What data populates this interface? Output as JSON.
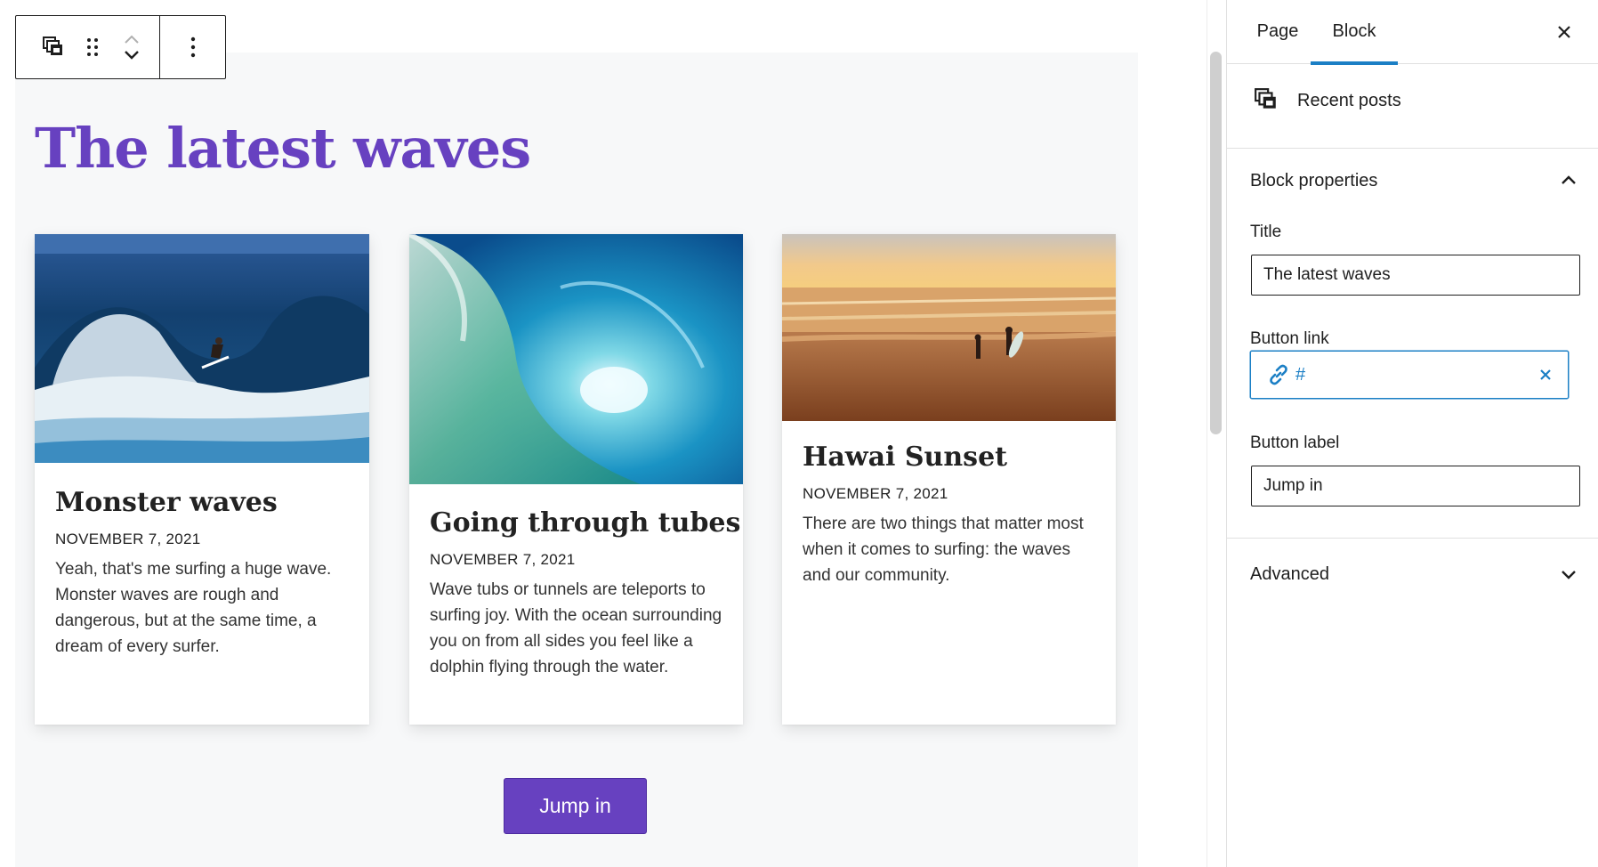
{
  "toolbar": {
    "block_type_icon": "recent-posts-icon",
    "drag_icon": "drag-handle-icon",
    "move_up_icon": "chevron-up-icon",
    "move_down_icon": "chevron-down-icon",
    "options_icon": "more-vertical-icon"
  },
  "block": {
    "title": "The latest waves",
    "posts": [
      {
        "title": "Monster waves",
        "date": "NOVEMBER 7, 2021",
        "excerpt": "Yeah, that's me surfing a huge wave. Monster waves are rough and dangerous, but at the same time, a dream of every surfer.",
        "image": "surfer-riding-large-wave"
      },
      {
        "title": "Going through tubes",
        "date": "NOVEMBER 7, 2021",
        "excerpt": "Wave tubs or tunnels are teleports to surfing joy. With the ocean surrounding you on from all sides you feel like a dolphin flying through the water.",
        "image": "turquoise-wave-tube"
      },
      {
        "title": "Hawai Sunset",
        "date": "NOVEMBER 7, 2021",
        "excerpt": "There are two things that matter most when it comes to surfing: the waves and our community.",
        "image": "surfers-on-beach-at-sunset"
      }
    ],
    "button_label": "Jump in"
  },
  "sidebar": {
    "tabs": [
      "Page",
      "Block"
    ],
    "active_tab": "Block",
    "close_icon": "close-icon",
    "block_name": "Recent posts",
    "block_properties_title": "Block properties",
    "fields": {
      "title_label": "Title",
      "title_value": "The latest waves",
      "button_link_label": "Button link",
      "button_link_value": "#",
      "button_label_label": "Button label",
      "button_label_value": "Jump in"
    },
    "advanced_title": "Advanced"
  },
  "colors": {
    "accent": "#6741c0",
    "link_blue": "#1b7fc5",
    "canvas_bg": "#f7f8f9"
  }
}
